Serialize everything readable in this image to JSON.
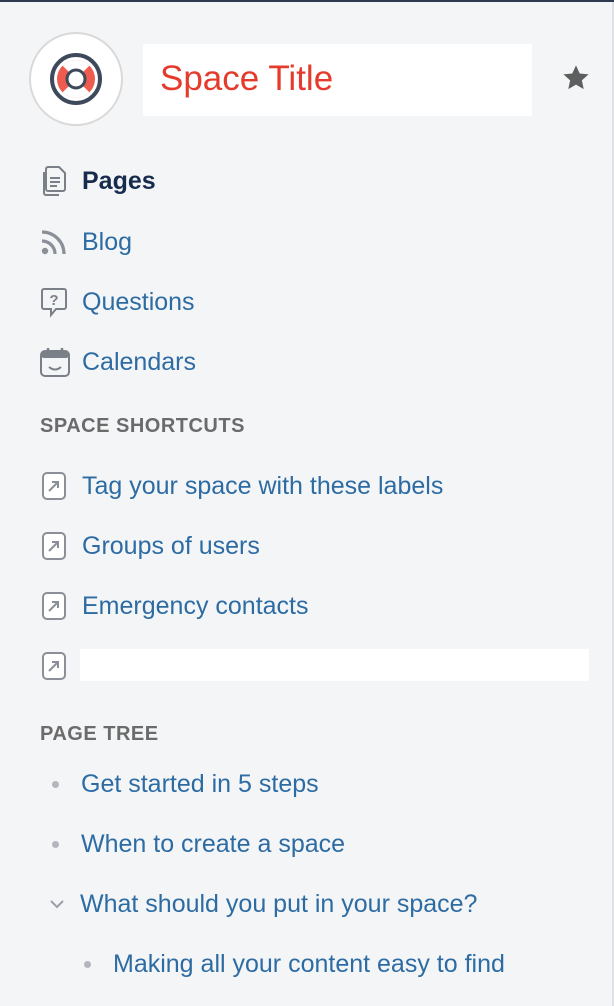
{
  "header": {
    "title": "Space Title",
    "logo_icon": "lifebuoy-icon",
    "favorite_icon": "star-icon"
  },
  "nav": [
    {
      "label": "Pages",
      "icon": "pages-icon",
      "active": true
    },
    {
      "label": "Blog",
      "icon": "rss-icon",
      "active": false
    },
    {
      "label": "Questions",
      "icon": "question-icon",
      "active": false
    },
    {
      "label": "Calendars",
      "icon": "calendar-icon",
      "active": false
    }
  ],
  "shortcuts": {
    "heading": "SPACE SHORTCUTS",
    "items": [
      {
        "label": "Tag your space with these labels",
        "icon": "external-link-icon"
      },
      {
        "label": "Groups of users",
        "icon": "external-link-icon"
      },
      {
        "label": "Emergency contacts",
        "icon": "external-link-icon"
      },
      {
        "label": "",
        "icon": "external-link-icon"
      }
    ]
  },
  "page_tree": {
    "heading": "PAGE TREE",
    "items": [
      {
        "label": "Get started in 5 steps",
        "level": 0,
        "expandable": false
      },
      {
        "label": "When to create a space",
        "level": 0,
        "expandable": false
      },
      {
        "label": "What should you put in your space?",
        "level": 0,
        "expandable": true,
        "expanded": true
      },
      {
        "label": "Making all your content easy to find",
        "level": 1,
        "expandable": false
      }
    ]
  },
  "colors": {
    "background": "#f4f5f7",
    "link": "#2d6ba3",
    "title": "#e53b2c",
    "heading": "#6b6b6b",
    "icon": "#8a8f98"
  }
}
